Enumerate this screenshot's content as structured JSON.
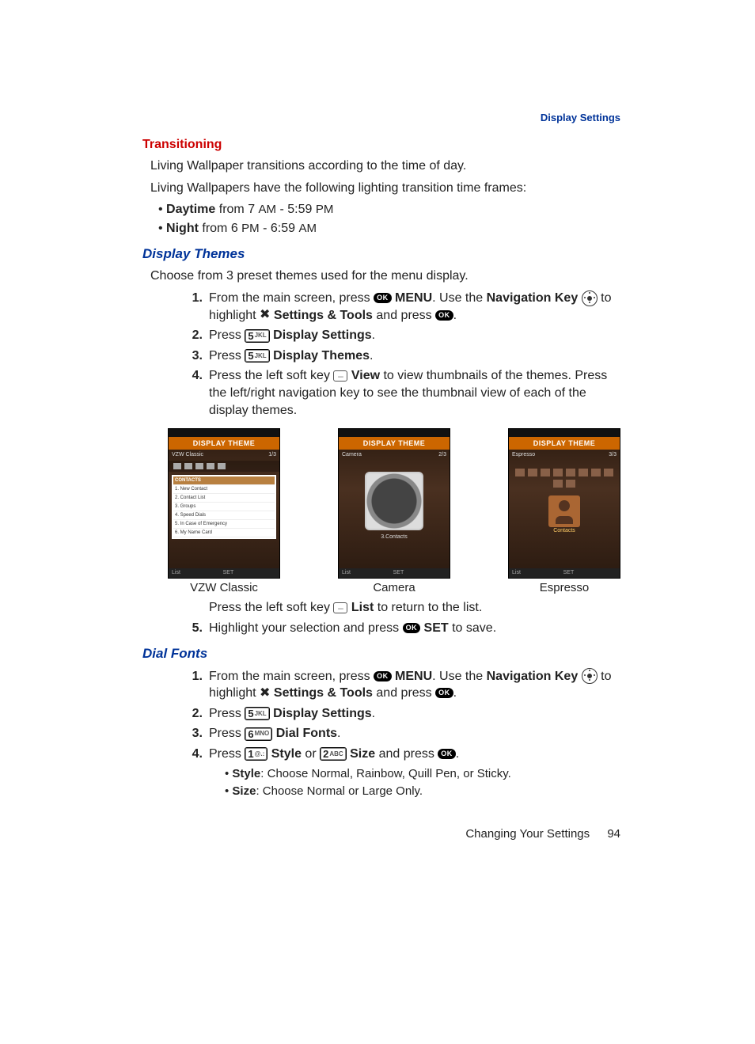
{
  "header": {
    "section": "Display Settings"
  },
  "transitioning": {
    "title": "Transitioning",
    "p1": "Living Wallpaper transitions according to the time of day.",
    "p2": "Living Wallpapers have the following lighting transition time frames:",
    "b1_label": "Daytime",
    "b1_rest": " from 7 ",
    "b1_tail": " - 5:59 ",
    "am": "AM",
    "pm": "PM",
    "b2_label": "Night",
    "b2_rest": " from 6 ",
    "b2_tail": " - 6:59 "
  },
  "display_themes": {
    "title": "Display Themes",
    "intro": "Choose from 3 preset themes used for the menu display.",
    "s1_a": "From the main screen, press ",
    "s1_menu": "MENU",
    "s1_b": ". Use the ",
    "s1_navkey": "Navigation Key",
    "s1_c": " to highlight ",
    "s1_settings": "Settings & Tools",
    "s1_d": " and press ",
    "s1_e": ".",
    "s2_a": "Press ",
    "s2_label": "Display Settings",
    "s3_a": "Press ",
    "s3_label": "Display Themes",
    "s4_a": "Press the left soft key ",
    "s4_view": "View",
    "s4_b": " to view thumbnails of the themes. Press the left/right navigation key to see the thumbnail view of each of the display themes.",
    "after_thumbs_a": "Press the left soft key ",
    "after_thumbs_list": "List",
    "after_thumbs_b": " to return to the list.",
    "s5_a": "Highlight your selection and press ",
    "s5_set": "SET",
    "s5_b": " to save."
  },
  "thumbs": {
    "title": "DISPLAY THEME",
    "bot_left": "List",
    "bot_mid": "SET",
    "c1": {
      "caption": "VZW Classic",
      "sub_left": "VZW Classic",
      "sub_right": "1/3",
      "list": [
        "1. New Contact",
        "2. Contact List",
        "3. Groups",
        "4. Speed Dials",
        "5. In Case of Emergency",
        "6. My Name Card"
      ],
      "list_hdr": "CONTACTS"
    },
    "c2": {
      "caption": "Camera",
      "sub_left": "Camera",
      "sub_right": "2/3",
      "lbl": "3.Contacts"
    },
    "c3": {
      "caption": "Espresso",
      "sub_left": "Espresso",
      "sub_right": "3/3",
      "lbl": "Contacts"
    }
  },
  "dial_fonts": {
    "title": "Dial Fonts",
    "s1_a": "From the main screen, press ",
    "s1_menu": "MENU",
    "s1_b": ". Use the ",
    "s1_navkey": "Navigation Key",
    "s1_c": " to highlight ",
    "s1_settings": "Settings & Tools",
    "s1_d": " and press ",
    "s1_e": ".",
    "s2_a": "Press ",
    "s2_label": "Display Settings",
    "s3_a": "Press ",
    "s3_label": "Dial Fonts",
    "s4_a": "Press ",
    "s4_style": "Style",
    "s4_or": " or ",
    "s4_size": "Size",
    "s4_b": " and press ",
    "s4_c": ".",
    "sub1_label": "Style",
    "sub1_rest": ": Choose Normal, Rainbow, Quill Pen, or Sticky.",
    "sub2_label": "Size",
    "sub2_rest": ": Choose Normal or Large Only."
  },
  "keys": {
    "ok": "OK",
    "five": {
      "d": "5",
      "l": "JKL"
    },
    "six": {
      "d": "6",
      "l": "MNO"
    },
    "one": {
      "d": "1",
      "l": "@.:"
    },
    "two": {
      "d": "2",
      "l": "ABC"
    }
  },
  "footer": {
    "chapter": "Changing Your Settings",
    "page": "94"
  }
}
